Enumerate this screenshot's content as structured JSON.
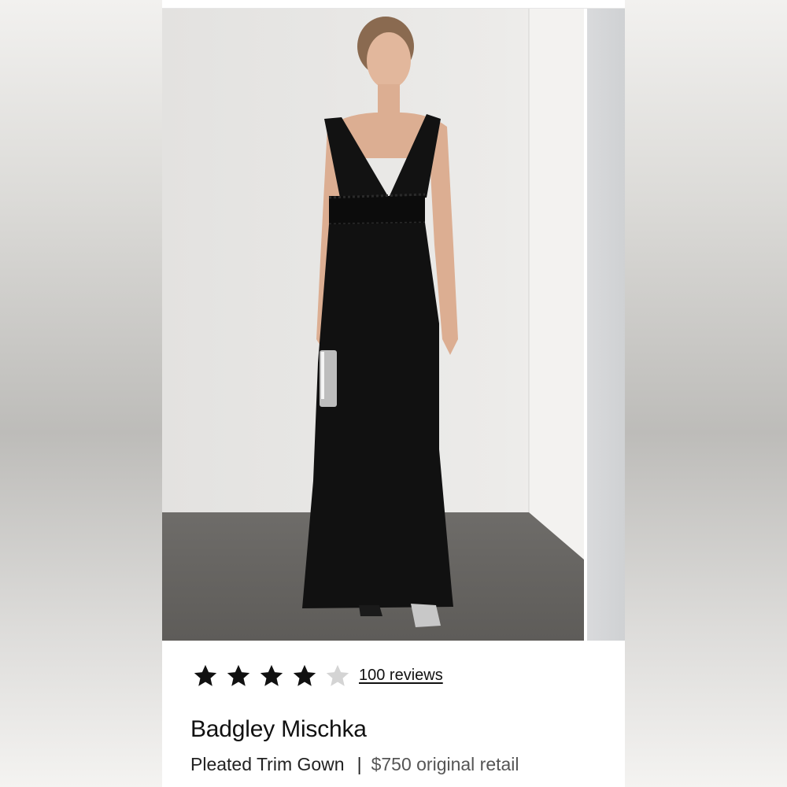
{
  "product": {
    "rating": 4,
    "rating_max": 5,
    "reviews_label": "100 reviews",
    "brand": "Badgley Mischka",
    "name": "Pleated Trim Gown",
    "separator": "|",
    "price_note": "$750 original retail"
  },
  "colors": {
    "star_filled": "#111111",
    "star_empty": "#d4d4d4"
  },
  "icons": {
    "star": "star-icon"
  }
}
